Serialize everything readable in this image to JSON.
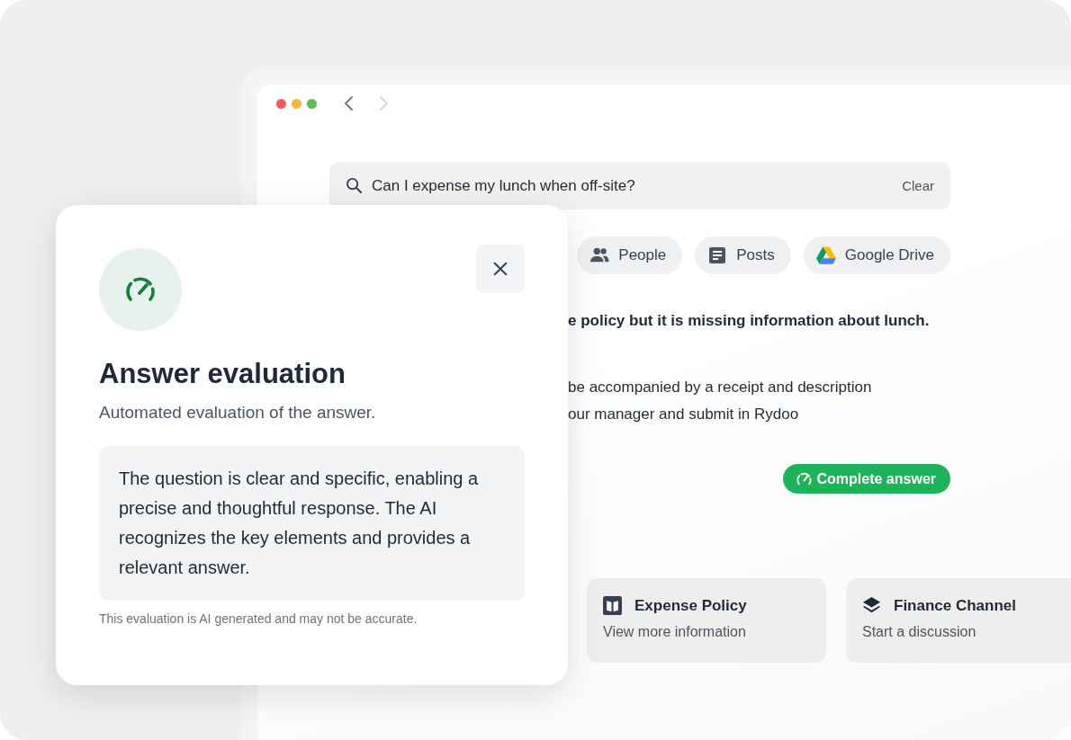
{
  "browser": {
    "search": {
      "value": "Can I expense my lunch when off-site?",
      "clear_label": "Clear"
    },
    "filters": [
      {
        "label": "People",
        "kind": "people"
      },
      {
        "label": "Posts",
        "kind": "posts"
      },
      {
        "label": "Google Drive",
        "kind": "drive"
      }
    ],
    "answer": {
      "summary": "e policy but it is missing information about lunch.",
      "lines": [
        "be accompanied by a receipt and description",
        "our manager and submit in Rydoo"
      ],
      "badge": "Complete answer"
    },
    "sources": [
      {
        "title": "Expense Policy",
        "subtitle": "View more information",
        "kind": "book"
      },
      {
        "title": "Finance Channel",
        "subtitle": "Start a discussion",
        "kind": "layers"
      }
    ]
  },
  "dialog": {
    "title": "Answer evaluation",
    "subtitle": "Automated evaluation of the answer.",
    "evaluation": "The question is clear and specific, enabling a precise and thoughtful response. The AI recognizes the key elements and provides a relevant answer.",
    "disclaimer": "This evaluation is AI generated and may not be accurate."
  }
}
